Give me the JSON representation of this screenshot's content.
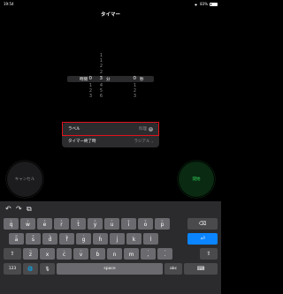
{
  "status": {
    "time": "19:54",
    "battery": "83%"
  },
  "title": "タイマー",
  "picker": {
    "hours": {
      "values": [
        "0",
        "1",
        "2",
        "3"
      ],
      "unit": "時間"
    },
    "minutes": {
      "values_above": [
        "1",
        "2"
      ],
      "selected": "3",
      "values_below": [
        "4",
        "5",
        "6"
      ],
      "unit": "分"
    },
    "seconds": {
      "values": [
        "0",
        "1",
        "2",
        "3"
      ],
      "unit": "秒"
    }
  },
  "settings": {
    "label_row": {
      "label": "ラベル",
      "value": "料理"
    },
    "end_row": {
      "label": "タイマー終了時",
      "value": "ラジアル"
    }
  },
  "buttons": {
    "cancel": "キャンセル",
    "start": "開始"
  },
  "keyboard": {
    "toolbar": {
      "undo": "↶",
      "redo": "↷",
      "paste": "⧉"
    },
    "row1": [
      {
        "sub": "1",
        "key": "q"
      },
      {
        "sub": "2",
        "key": "w"
      },
      {
        "sub": "3",
        "key": "e"
      },
      {
        "sub": "4",
        "key": "r"
      },
      {
        "sub": "5",
        "key": "t"
      },
      {
        "sub": "6",
        "key": "y"
      },
      {
        "sub": "7",
        "key": "u"
      },
      {
        "sub": "8",
        "key": "i"
      },
      {
        "sub": "9",
        "key": "o"
      },
      {
        "sub": "0",
        "key": "p"
      }
    ],
    "row2": [
      {
        "sub": "@",
        "key": "a"
      },
      {
        "sub": "#",
        "key": "s"
      },
      {
        "sub": "$",
        "key": "d"
      },
      {
        "sub": "&",
        "key": "f"
      },
      {
        "sub": "*",
        "key": "g"
      },
      {
        "sub": "(",
        "key": "h"
      },
      {
        "sub": ")",
        "key": "j"
      },
      {
        "sub": "'",
        "key": "k"
      },
      {
        "sub": "\"",
        "key": "l"
      }
    ],
    "row3": [
      {
        "sub": "%",
        "key": "z"
      },
      {
        "sub": "-",
        "key": "x"
      },
      {
        "sub": "+",
        "key": "c"
      },
      {
        "sub": "=",
        "key": "v"
      },
      {
        "sub": "/",
        "key": "b"
      },
      {
        "sub": ";",
        "key": "n"
      },
      {
        "sub": ":",
        "key": "m"
      },
      {
        "sub": "!",
        "key": ","
      },
      {
        "sub": "?",
        "key": "."
      }
    ],
    "delete": "⌫",
    "return": "⏎",
    "shift": "⇧",
    "bottom": {
      "numbers": "123",
      "globe": "🌐",
      "mic": "🎙",
      "space": "space",
      "abc": "abc",
      "hide": "⌨"
    },
    "row2_return": "⏎"
  }
}
